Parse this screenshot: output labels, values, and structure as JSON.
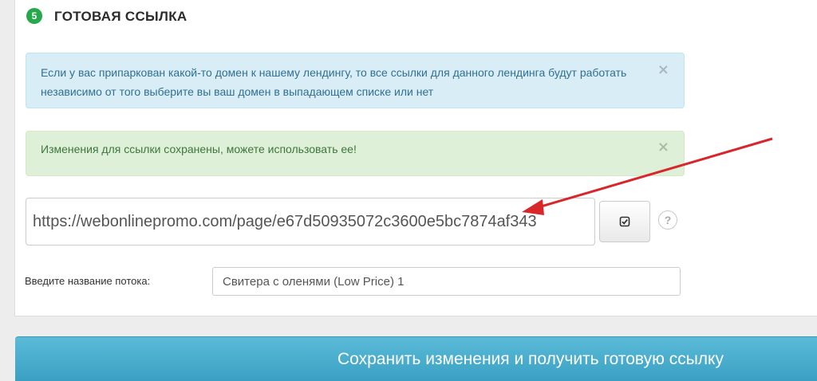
{
  "section": {
    "step_number": "5",
    "title": "ГОТОВАЯ ССЫЛКА"
  },
  "alerts": {
    "info": {
      "text": "Если у вас припаркован какой-то домен к нашему лендингу, то все ссылки для данного лендинга будут работать независимо от того выберите вы ваш домен в выпадающем списке или нет",
      "close": "×"
    },
    "success": {
      "text": "Изменения для ссылки сохранены, можете использовать ее!",
      "close": "×"
    }
  },
  "link": {
    "value": "https://webonlinepromo.com/page/e67d50935072c3600e5bc7874af343",
    "copy_icon": "check-square-icon",
    "help_label": "?"
  },
  "stream": {
    "label": "Введите название потока:",
    "value": "Свитера с оленями (Low Price) 1"
  },
  "footer": {
    "save_label": "Сохранить изменения и получить готовую ссылку"
  },
  "colors": {
    "badge": "#27a84a",
    "info_bg": "#d9edf7",
    "success_bg": "#dff0d8",
    "button": "#3aa0c3",
    "arrow": "#d9262a"
  }
}
